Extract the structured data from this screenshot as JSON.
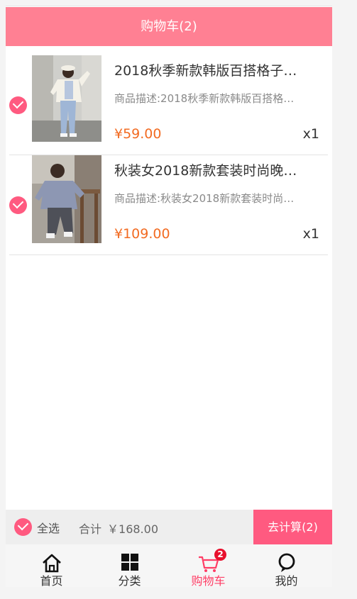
{
  "header": {
    "title": "购物车(2)"
  },
  "items": [
    {
      "title": "2018秋季新款韩版百搭格子…",
      "description": "商品描述:2018秋季新款韩版百搭格…",
      "price": "¥59.00",
      "quantity": "x1",
      "selected": true
    },
    {
      "title": "秋装女2018新款套装时尚晚…",
      "description": "商品描述:秋装女2018新款套装时尚…",
      "price": "¥109.00",
      "quantity": "x1",
      "selected": true
    }
  ],
  "footer": {
    "select_all_label": "全选",
    "total_label": "合计",
    "total_amount": "￥168.00",
    "checkout_label": "去计算(2)"
  },
  "tabbar": {
    "tabs": [
      {
        "label": "首页",
        "icon": "home-icon"
      },
      {
        "label": "分类",
        "icon": "grid-icon"
      },
      {
        "label": "购物车",
        "icon": "cart-icon",
        "badge": "2",
        "active": true
      },
      {
        "label": "我的",
        "icon": "profile-icon"
      }
    ]
  },
  "colors": {
    "header": "#ff8093",
    "accent": "#ff5a80",
    "price": "#f26b22",
    "badge": "#e8102d",
    "active_tab": "#ff3d65"
  }
}
